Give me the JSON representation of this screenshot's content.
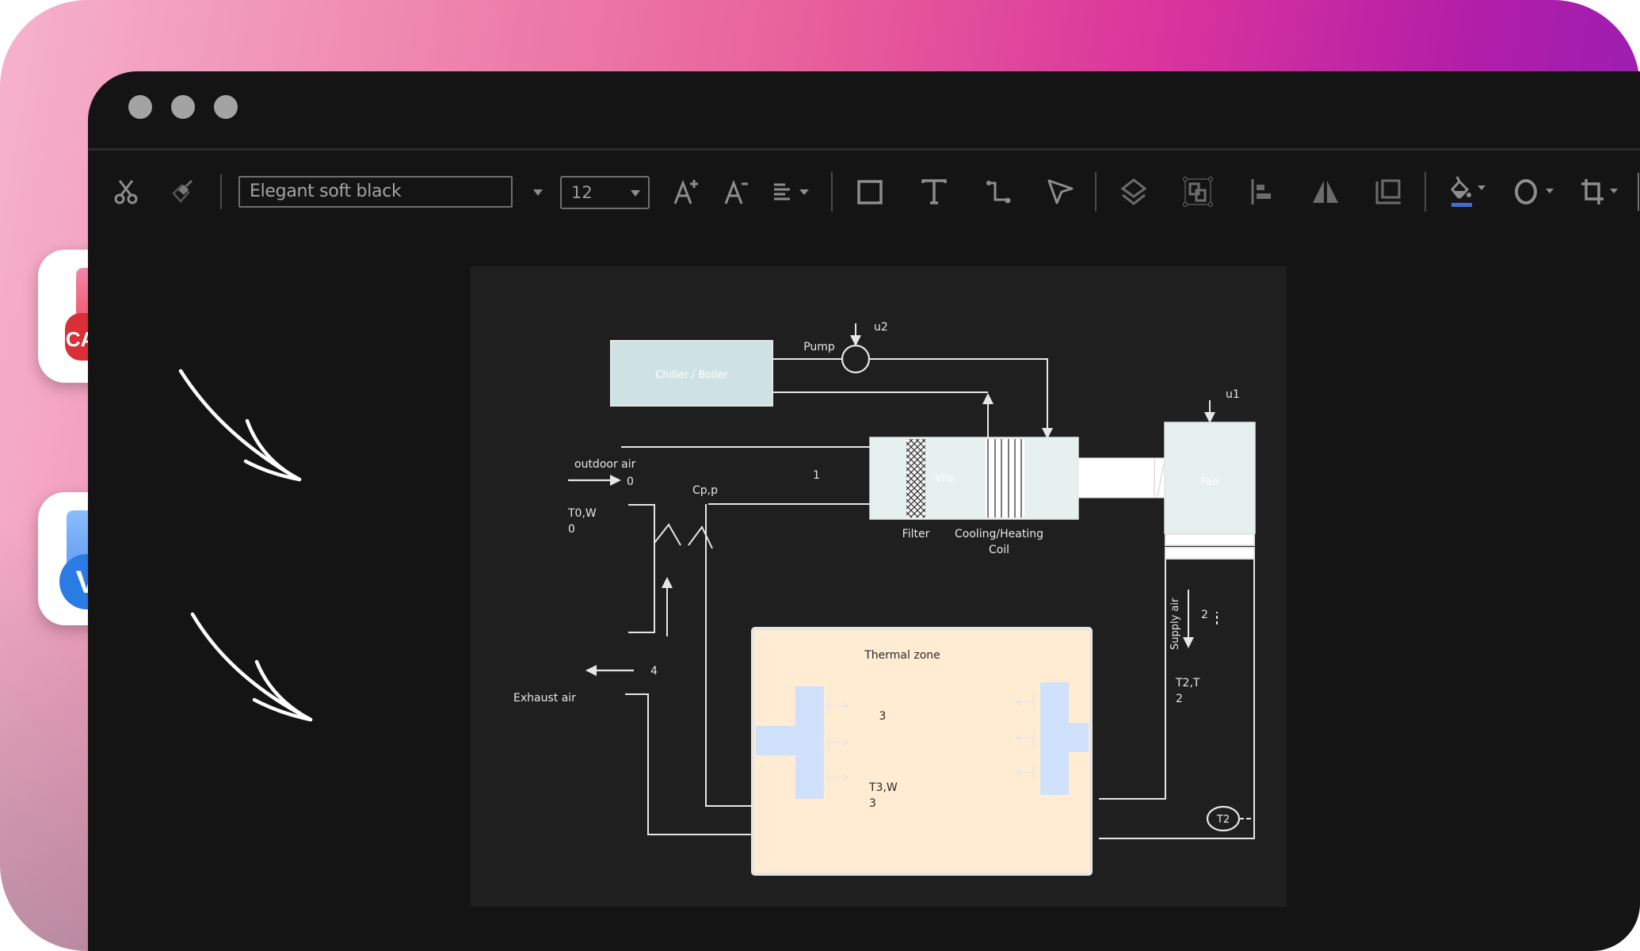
{
  "window": {
    "controls": [
      "close",
      "minimize",
      "maximize"
    ]
  },
  "toolbar": {
    "font_name": "Elegant soft black",
    "font_size": "12",
    "icons": [
      "scissors-icon",
      "format-painter-icon",
      "font-dropdown-caret",
      "increase-font-icon",
      "decrease-font-icon",
      "align-icon",
      "rectangle-icon",
      "text-icon",
      "connector-icon",
      "pointer-icon",
      "layers-icon",
      "group-icon",
      "align-left-icon",
      "flip-icon",
      "frame-icon",
      "fill-icon",
      "shape-style-icon",
      "crop-icon"
    ],
    "fill_color": "#3f6fd6"
  },
  "side_apps": [
    {
      "name": "CAD",
      "label": "CAD",
      "color": "#e53945"
    },
    {
      "name": "Visio",
      "label": "V",
      "color": "#2f7de6"
    }
  ],
  "diagram": {
    "chiller_label": "Chiller / Boiler",
    "pump_label": "Pump",
    "u2_label": "u2",
    "u1_label": "u1",
    "outdoor_air_label": "outdoor air",
    "node0_label": "0",
    "node1_label": "1",
    "node2_label": "2",
    "node4_label": "4",
    "cpp_label": "Cp,p",
    "t0w_label": "T0,W",
    "t0w_sub": "0",
    "vhe_label": "Vhe",
    "fan_label": "Fan",
    "filter_label": "Filter",
    "coil_label_1": "Cooling/Heating",
    "coil_label_2": "Coil",
    "supply_air_label": "Supply air",
    "t2t_label": "T2,T",
    "t2t_sub": "2",
    "t2_sensor_label": "T2",
    "exhaust_air_label": "Exhaust air",
    "thermal_zone_label": "Thermal zone",
    "zone_node_label": "3",
    "t3w_label": "T3,W",
    "t3w_sub": "3"
  },
  "colors": {
    "canvas": "#1f1f1f",
    "line": "#e6e6e6",
    "chiller_fill": "#cfe2e3",
    "ahu_fill": "#e6f0ee",
    "zone_fill": "#ffecd2",
    "diffuser_fill": "#d0e1fb"
  }
}
